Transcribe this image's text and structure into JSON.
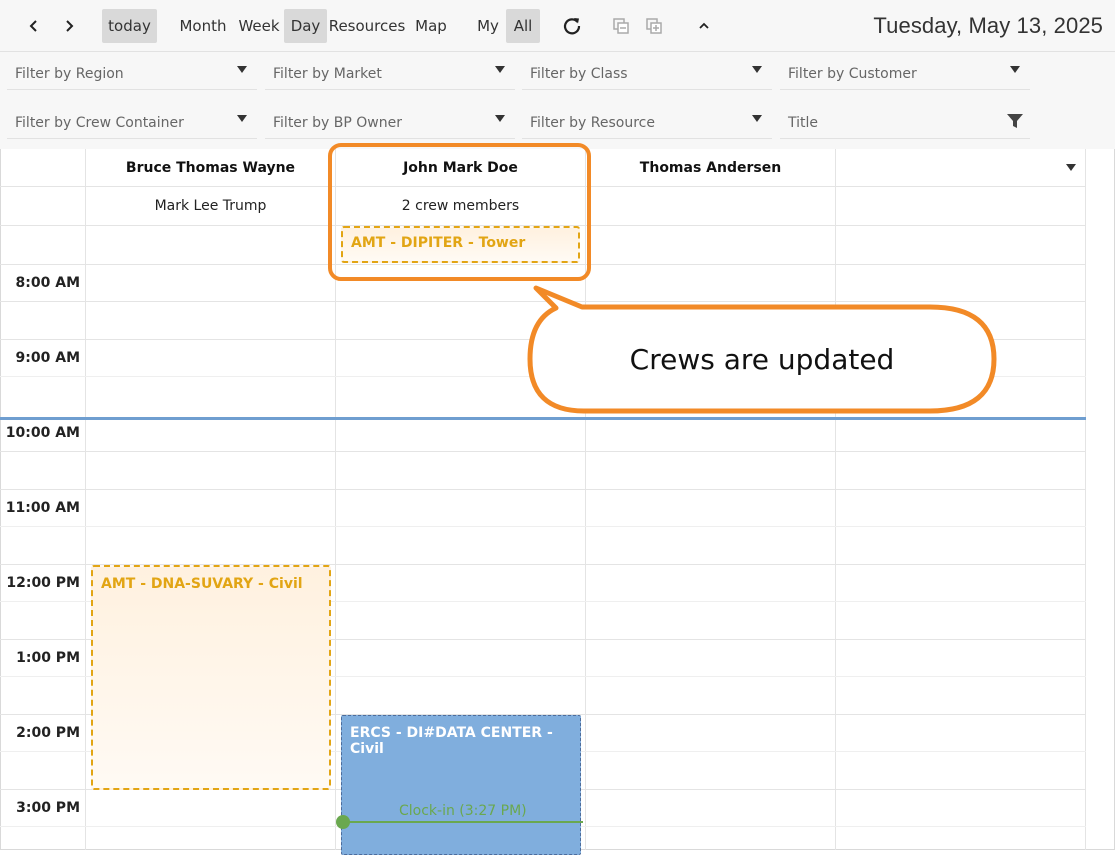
{
  "toolbar": {
    "today_label": "today",
    "views": [
      "Month",
      "Week",
      "Day",
      "Resources",
      "Map"
    ],
    "active_view": "Day",
    "scope": [
      "My",
      "All"
    ],
    "active_scope": "All",
    "date_title": "Tuesday, May 13, 2025"
  },
  "filters": {
    "region": "Filter by Region",
    "market": "Filter by Market",
    "class": "Filter by Class",
    "customer": "Filter by Customer",
    "crew_container": "Filter by Crew Container",
    "bp_owner": "Filter by BP Owner",
    "resource": "Filter by Resource",
    "title": "Title"
  },
  "resources": [
    {
      "name": "Bruce Thomas Wayne",
      "crew": "Mark Lee Trump"
    },
    {
      "name": "John Mark Doe",
      "crew": "2 crew members"
    },
    {
      "name": "Thomas Andersen",
      "crew": ""
    }
  ],
  "times": [
    "8:00 AM",
    "9:00 AM",
    "10:00 AM",
    "11:00 AM",
    "12:00 PM",
    "1:00 PM",
    "2:00 PM",
    "3:00 PM"
  ],
  "events": {
    "allday_doe": "AMT - DIPITER - Tower",
    "wayne_noon": "AMT - DNA-SUVARY - Civil",
    "doe_two": "ERCS - DI#DATA CENTER - Civil",
    "clock_in": "Clock-in (3:27 PM)"
  },
  "callout": {
    "text": "Crews are updated"
  },
  "colors": {
    "accent_orange": "#f28a27",
    "event_orange": "#e2a514",
    "event_blue": "#80aedd",
    "now_line": "#6f9ed0",
    "clock_green": "#6aa84f"
  }
}
